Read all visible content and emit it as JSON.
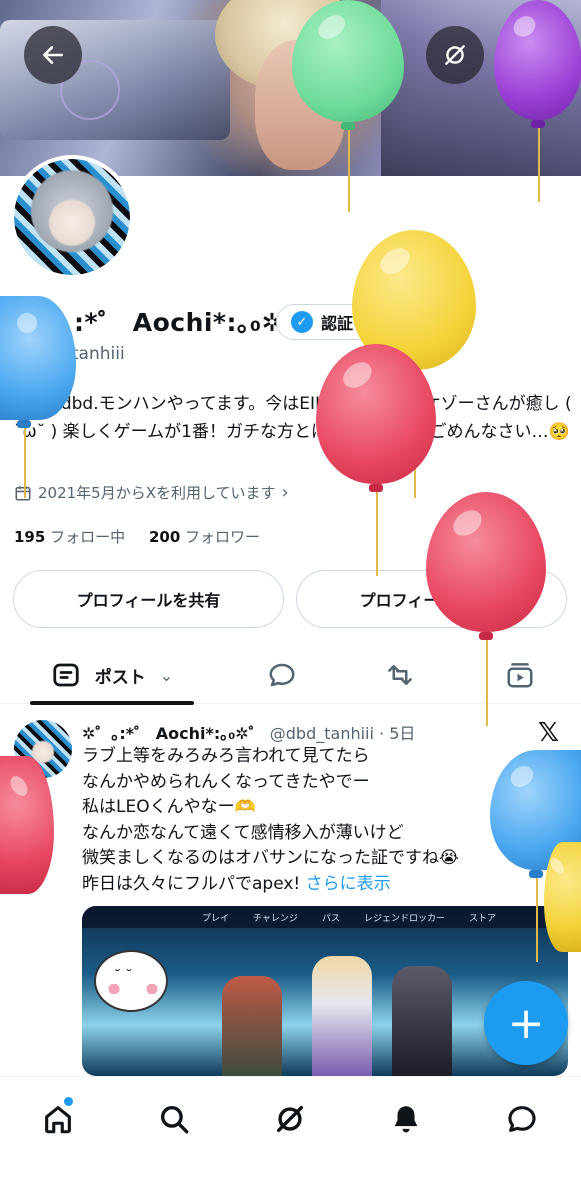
{
  "header": {
    "back_icon": "arrow-left-icon",
    "grok_icon": "grok-icon",
    "search_icon": "search-icon"
  },
  "profile": {
    "display_name": "✲゜｡:*゜ Aochi*:｡₀✲゜",
    "verify_button_label": "認証を受ける",
    "handle": "@dbd_tanhiii",
    "bio": "apex.dbd.モンハンやってます。今はEIKOちゃんとタケゾーさんが癒し ( ˘ω˘ ) 楽しくゲームが1番！ガチな方とは遊べません、ごめんなさい…🥺",
    "joined": "2021年5月からXを利用しています",
    "following_count": "195",
    "following_label": "フォロー中",
    "followers_count": "200",
    "followers_label": "フォロワー"
  },
  "actions": {
    "share_profile": "プロフィールを共有",
    "edit_profile": "プロフィールを編集"
  },
  "tabs": {
    "posts_label": "ポスト"
  },
  "post": {
    "author_name": "✲゜｡:*゜ Aochi*:｡₀✲゜",
    "author_handle": "@dbd_tanhiii",
    "separator": "·",
    "time": "5日",
    "lines": [
      "ラブ上等をみろみろ言われて見てたら",
      "なんかやめられんくなってきたやでー",
      "私はLEOくんやなー🫶",
      "なんか恋なんて遠くて感情移入が薄いけど",
      "微笑ましくなるのはオバサンになった証ですね😭",
      "昨日は久々にフルパでapex! "
    ],
    "show_more": "さらに表示",
    "media_nav": [
      "プレイ",
      "チャレンジ",
      "パス",
      "レジェンドロッカー",
      "ストア"
    ]
  },
  "colors": {
    "accent": "#1d9bf0",
    "text": "#0f1419",
    "secondary": "#536471",
    "balloon_green": "#6fdc9a",
    "balloon_purple": "#9b3fd6",
    "balloon_yellow": "#f5d33a",
    "balloon_red": "#e8465f",
    "balloon_blue": "#4aa8f0"
  },
  "bottom_nav": [
    "home-icon",
    "search-icon",
    "grok-icon",
    "notifications-icon",
    "messages-icon"
  ]
}
